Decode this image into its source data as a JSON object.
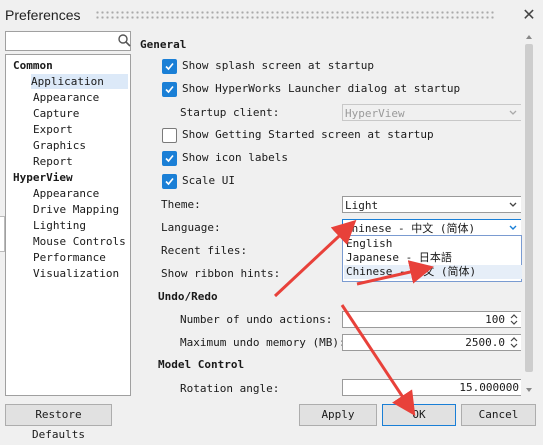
{
  "window": {
    "title": "Preferences",
    "close_glyph": "✕"
  },
  "search": {
    "placeholder": ""
  },
  "tree": {
    "groups": [
      {
        "label": "Common",
        "items": [
          "Application",
          "Appearance",
          "Capture",
          "Export",
          "Graphics",
          "Report"
        ]
      },
      {
        "label": "HyperView",
        "items": [
          "Appearance",
          "Drive Mapping",
          "Lighting",
          "Mouse Controls",
          "Performance",
          "Visualization"
        ]
      }
    ],
    "selected": "Application"
  },
  "general": {
    "heading": "General",
    "splash_label": "Show splash screen at startup",
    "launcher_label": "Show HyperWorks Launcher dialog at startup",
    "startup_client_label": "Startup client:",
    "startup_client_value": "HyperView",
    "getting_started_label": "Show Getting Started screen at startup",
    "icon_labels_label": "Show icon labels",
    "scale_ui_label": "Scale UI",
    "theme_label": "Theme:",
    "theme_value": "Light",
    "language_label": "Language:",
    "language_value": "Chinese - 中文 (简体)",
    "language_options": [
      "English",
      "Japanese - 日本語",
      "Chinese - 中文 (简体)"
    ],
    "recent_files_label": "Recent files:",
    "ribbon_hints_label": "Show ribbon hints:"
  },
  "checks": {
    "splash": true,
    "launcher": true,
    "getting_started": false,
    "icon_labels": true,
    "scale_ui": true
  },
  "undo": {
    "heading": "Undo/Redo",
    "actions_label": "Number of undo actions:",
    "actions_value": "100",
    "memory_label": "Maximum undo memory (MB):",
    "memory_value": "2500.0"
  },
  "model_control": {
    "heading": "Model Control",
    "rotation_label": "Rotation angle:",
    "rotation_value": "15.000000"
  },
  "buttons": {
    "restore": "Restore Defaults",
    "apply": "Apply",
    "ok": "OK",
    "cancel": "Cancel"
  },
  "colors": {
    "accent": "#1a7fd6",
    "annotation": "#e8413a",
    "selection": "#dce9f8"
  }
}
